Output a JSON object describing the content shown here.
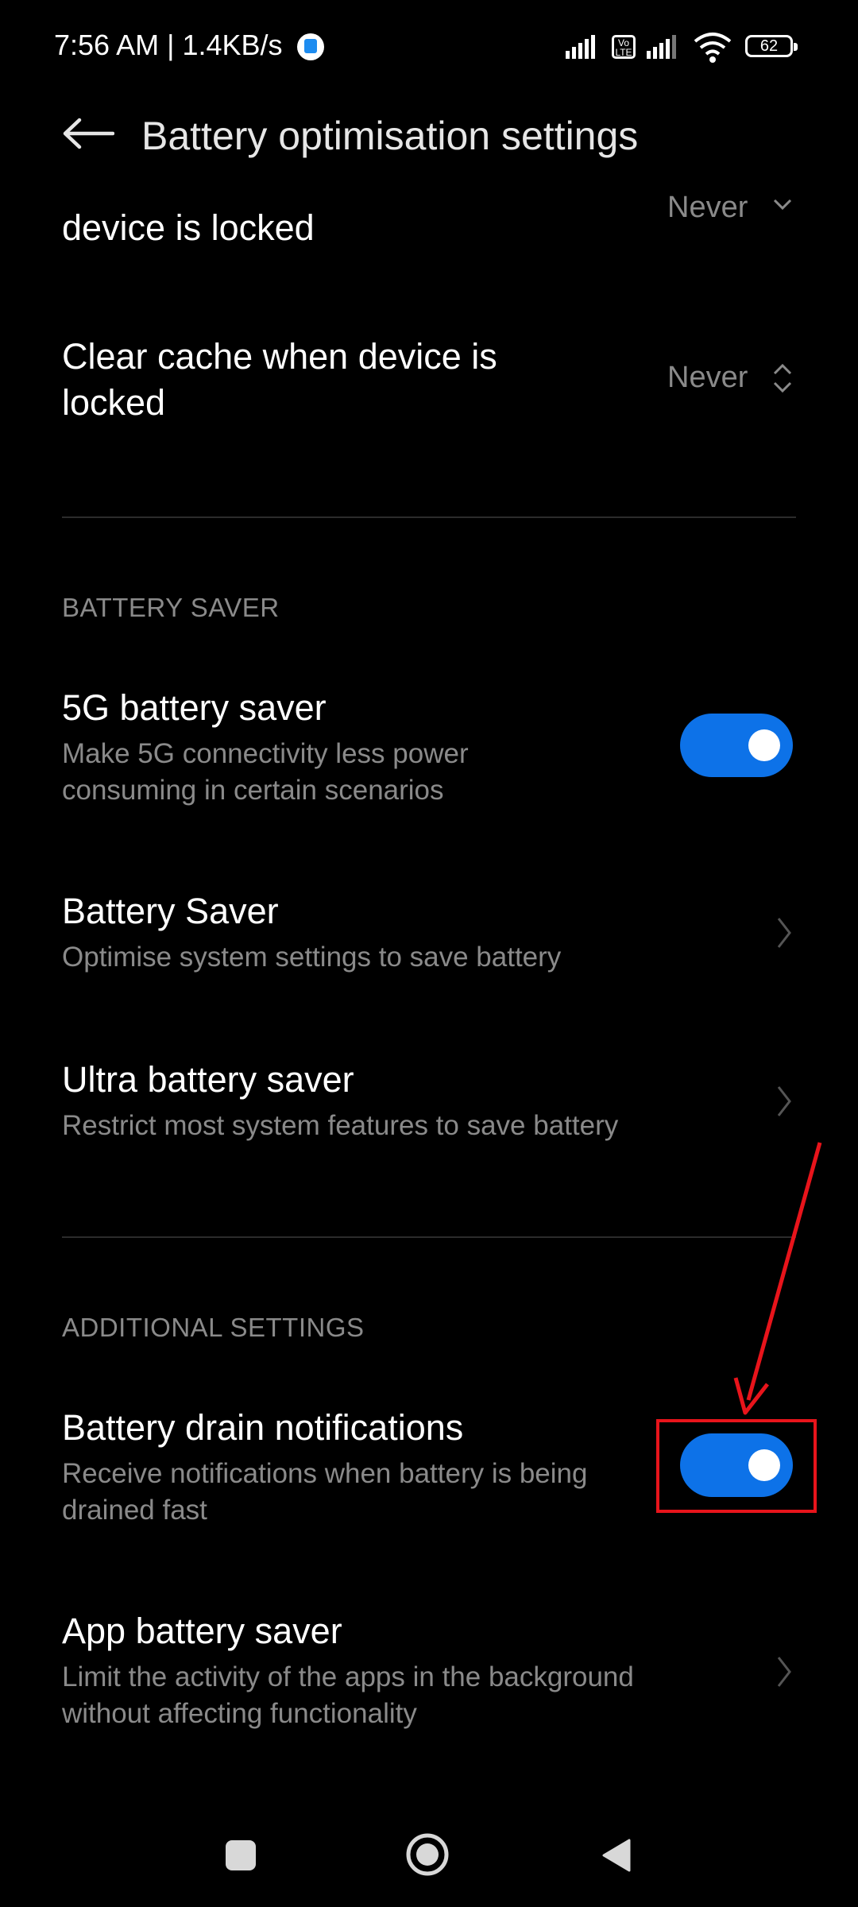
{
  "status_bar": {
    "time": "7:56 AM | 1.4KB/s",
    "battery": "62",
    "volte": "Vo LTE"
  },
  "header": {
    "title": "Battery optimisation settings"
  },
  "items": {
    "clear_data_locked": {
      "title": "device is locked",
      "value": "Never"
    },
    "clear_cache_locked": {
      "title_line1": "Clear cache when device is",
      "title_line2": "locked",
      "value": "Never"
    },
    "five_g_saver": {
      "title": "5G battery saver",
      "sub_line1": "Make 5G connectivity less power",
      "sub_line2": "consuming in certain scenarios",
      "enabled": true
    },
    "battery_saver": {
      "title": "Battery Saver",
      "sub": "Optimise system settings to save battery"
    },
    "ultra_saver": {
      "title": "Ultra battery saver",
      "sub": "Restrict most system features to save battery"
    },
    "drain_notifications": {
      "title": "Battery drain notifications",
      "sub_line1": "Receive notifications when battery is being",
      "sub_line2": "drained fast",
      "enabled": true
    },
    "app_saver": {
      "title": "App battery saver",
      "sub_line1": "Limit the activity of the apps in the background",
      "sub_line2": "without affecting functionality"
    }
  },
  "sections": {
    "battery_saver": "BATTERY SAVER",
    "additional": "ADDITIONAL SETTINGS"
  },
  "colors": {
    "accent": "#0d72e8",
    "annotation": "#e8141b"
  }
}
